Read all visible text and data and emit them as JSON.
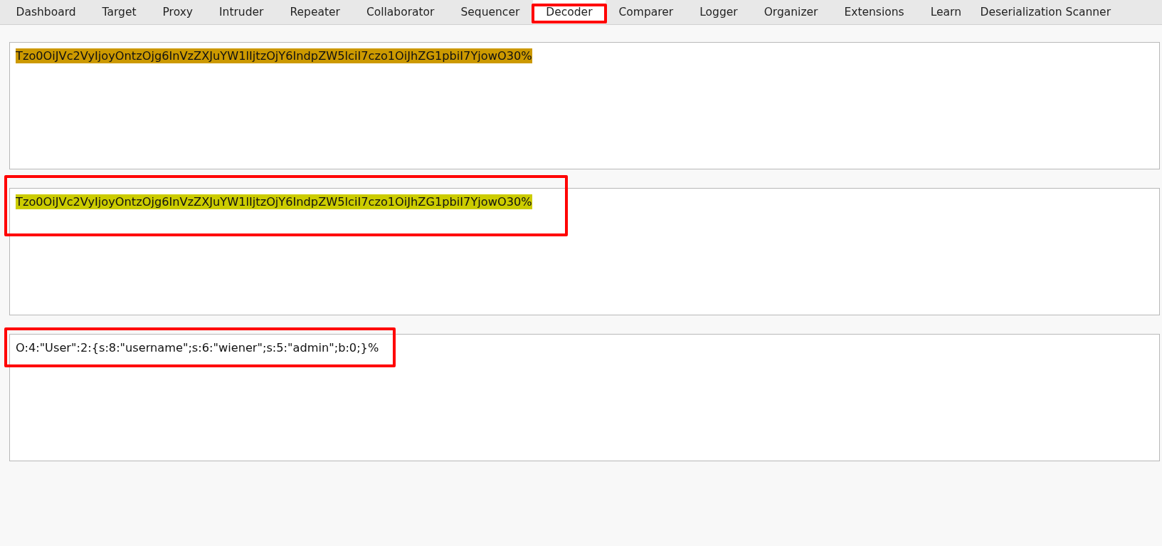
{
  "tabs": [
    {
      "label": "Dashboard",
      "selected": false,
      "annotated": false
    },
    {
      "label": "Target",
      "selected": false,
      "annotated": false
    },
    {
      "label": "Proxy",
      "selected": false,
      "annotated": false
    },
    {
      "label": "Intruder",
      "selected": false,
      "annotated": false
    },
    {
      "label": "Repeater",
      "selected": false,
      "annotated": false
    },
    {
      "label": "Collaborator",
      "selected": false,
      "annotated": false
    },
    {
      "label": "Sequencer",
      "selected": false,
      "annotated": false
    },
    {
      "label": "Decoder",
      "selected": true,
      "annotated": true
    },
    {
      "label": "Comparer",
      "selected": false,
      "annotated": false
    },
    {
      "label": "Logger",
      "selected": false,
      "annotated": false
    },
    {
      "label": "Organizer",
      "selected": false,
      "annotated": false
    },
    {
      "label": "Extensions",
      "selected": false,
      "annotated": false
    },
    {
      "label": "Learn",
      "selected": false,
      "annotated": false
    },
    {
      "label": "Deserialization Scanner",
      "selected": false,
      "annotated": false
    }
  ],
  "panels": [
    {
      "text": "Tzo0OiJVc2VyIjoyOntzOjg6InVzZXJuYW1lIjtzOjY6IndpZW5lciI7czo1OiJhZG1pbiI7YjowO30%",
      "color": "#cc9900",
      "annotated": false
    },
    {
      "text": "Tzo0OiJVc2VyIjoyOntzOjg6InVzZXJuYW1lIjtzOjY6IndpZW5lciI7czo1OiJhZG1pbiI7YjowO30%",
      "color": "#cccc00",
      "annotated": true
    },
    {
      "text": "O:4:\"User\":2:{s:8:\"username\";s:6:\"wiener\";s:5:\"admin\";b:0;}%",
      "annotated": true
    }
  ]
}
